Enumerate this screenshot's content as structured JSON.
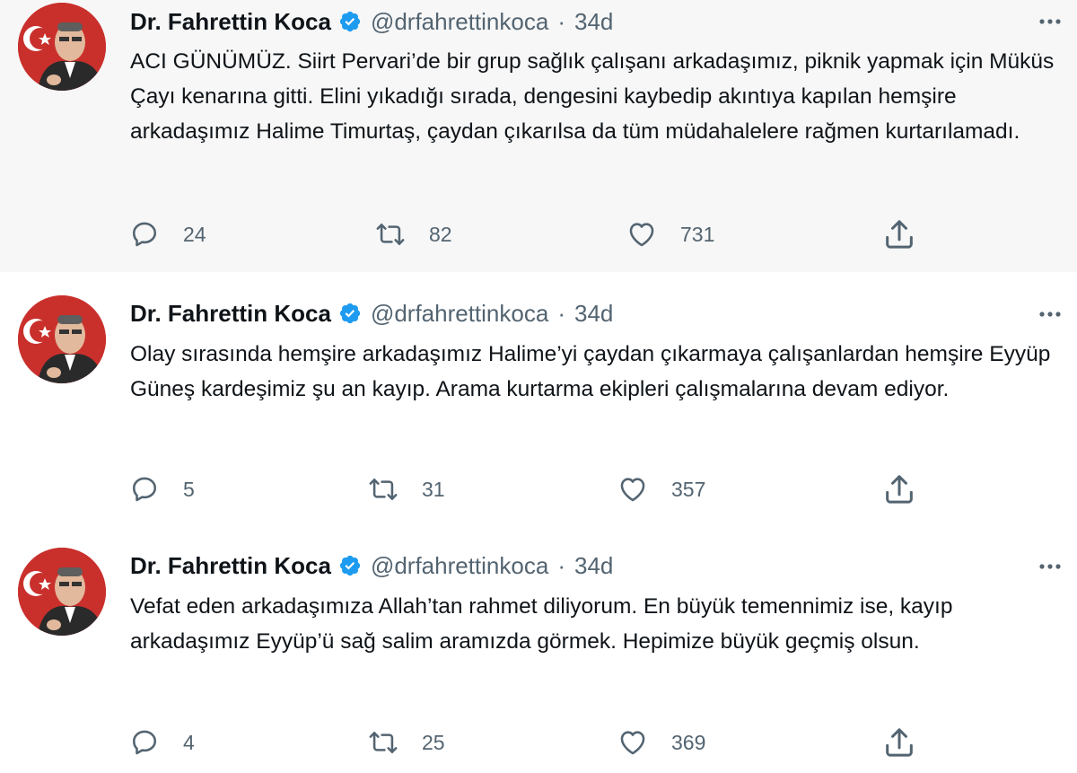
{
  "colors": {
    "thread_bg": "#f7f7f7",
    "verified": "#1d9bf0",
    "secondary_text": "#536471",
    "thread_line": "#cfd9de"
  },
  "tweets": [
    {
      "author_name": "Dr. Fahrettin Koca",
      "handle": "@drfahrettinkoca",
      "separator": "·",
      "time": "34d",
      "text": "ACI GÜNÜMÜZ. Siirt Pervari’de bir grup sağlık çalışanı arkadaşımız, piknik yapmak için Müküs Çayı kenarına gitti. Elini yıkadığı sırada, dengesini kaybedip akıntıya kapılan hemşire arkadaşımız Halime Timurtaş, çaydan çıkarılsa da tüm müdahalelere rağmen kurtarılamadı.",
      "replies": "24",
      "retweets": "82",
      "likes": "731"
    },
    {
      "author_name": "Dr. Fahrettin Koca",
      "handle": "@drfahrettinkoca",
      "separator": "·",
      "time": "34d",
      "text": "Olay sırasında hemşire arkadaşımız Halime’yi çaydan çıkarmaya çalışanlardan hemşire Eyyüp Güneş kardeşimiz şu an kayıp. Arama kurtarma ekipleri çalışmalarına devam ediyor.",
      "replies": "5",
      "retweets": "31",
      "likes": "357"
    },
    {
      "author_name": "Dr. Fahrettin Koca",
      "handle": "@drfahrettinkoca",
      "separator": "·",
      "time": "34d",
      "text": "Vefat eden arkadaşımıza Allah’tan rahmet diliyorum. En büyük temennimiz ise, kayıp arkadaşımız Eyyüp’ü sağ salim aramızda görmek. Hepimize büyük geçmiş olsun.",
      "replies": "4",
      "retweets": "25",
      "likes": "369"
    }
  ],
  "icons": {
    "reply": "reply-icon",
    "retweet": "retweet-icon",
    "like": "heart-icon",
    "share": "share-icon",
    "more": "more-icon",
    "verified": "verified-badge-icon"
  }
}
